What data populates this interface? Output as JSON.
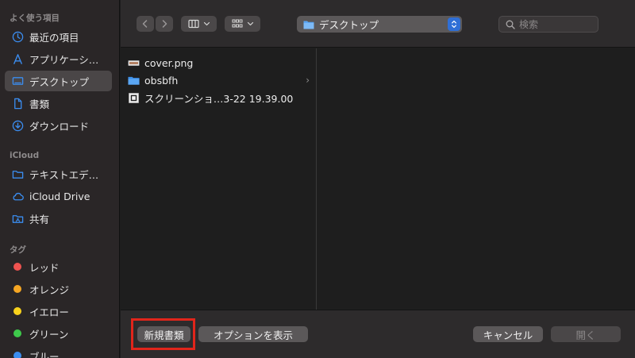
{
  "sidebar": {
    "favorites_header": "よく使う項目",
    "favorites": [
      {
        "label": "最近の項目",
        "icon": "clock-icon"
      },
      {
        "label": "アプリケーシ…",
        "icon": "applications-icon"
      },
      {
        "label": "デスクトップ",
        "icon": "desktop-icon"
      },
      {
        "label": "書類",
        "icon": "document-icon"
      },
      {
        "label": "ダウンロード",
        "icon": "download-icon"
      }
    ],
    "icloud_header": "iCloud",
    "icloud": [
      {
        "label": "テキストエデ…",
        "icon": "folder-icon"
      },
      {
        "label": "iCloud Drive",
        "icon": "cloud-icon"
      },
      {
        "label": "共有",
        "icon": "shared-folder-icon"
      }
    ],
    "tags_header": "タグ",
    "tags": [
      {
        "label": "レッド",
        "color": "#ef5350"
      },
      {
        "label": "オレンジ",
        "color": "#f5a623"
      },
      {
        "label": "イエロー",
        "color": "#f8d21c"
      },
      {
        "label": "グリーン",
        "color": "#3ec94b"
      },
      {
        "label": "ブルー",
        "color": "#3b8df0"
      }
    ]
  },
  "toolbar": {
    "path": "デスクトップ",
    "search_placeholder": "検索"
  },
  "files": [
    {
      "name": "cover.png",
      "icon": "image-file-icon"
    },
    {
      "name": "obsbfh",
      "icon": "folder-icon"
    },
    {
      "name": "スクリーンショ…3-22 19.39.00",
      "icon": "screenshot-file-icon"
    }
  ],
  "footer": {
    "new_document": "新規書類",
    "show_options": "オプションを表示",
    "cancel": "キャンセル",
    "open": "開く"
  },
  "colors": {
    "accent": "#2f6fd6",
    "highlight": "#e1251b",
    "sidebar_icon": "#3b8df0"
  }
}
